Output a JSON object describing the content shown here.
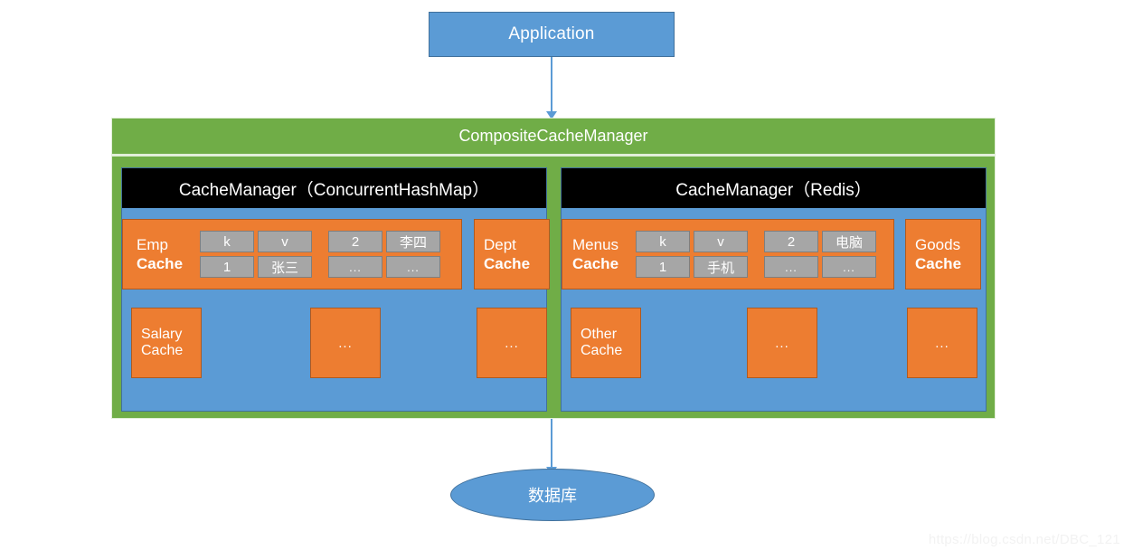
{
  "application": {
    "label": "Application"
  },
  "composite": {
    "title": "CompositeCacheManager"
  },
  "managers": [
    {
      "id": "concurrent-hash-map",
      "header": "CacheManager（ConcurrentHashMap）",
      "top_row": {
        "wide_cache": {
          "name": "Emp",
          "sub": "Cache",
          "tables": [
            {
              "rows": [
                [
                  "k",
                  "v"
                ],
                [
                  "1",
                  "张三"
                ]
              ]
            },
            {
              "rows": [
                [
                  "2",
                  "李四"
                ],
                [
                  "...",
                  "..."
                ]
              ]
            }
          ]
        },
        "small_cache": {
          "name": "Dept",
          "sub": "Cache"
        }
      },
      "bottom_row": {
        "named_cache": {
          "name": "Salary",
          "sub": "Cache"
        },
        "placeholder_caches": [
          "...",
          "..."
        ]
      }
    },
    {
      "id": "redis",
      "header": "CacheManager（Redis）",
      "top_row": {
        "wide_cache": {
          "name": "Menus",
          "sub": "Cache",
          "tables": [
            {
              "rows": [
                [
                  "k",
                  "v"
                ],
                [
                  "1",
                  "手机"
                ]
              ]
            },
            {
              "rows": [
                [
                  "2",
                  "电脑"
                ],
                [
                  "...",
                  "..."
                ]
              ]
            }
          ]
        },
        "small_cache": {
          "name": "Goods",
          "sub": "Cache"
        }
      },
      "bottom_row": {
        "named_cache": {
          "name": "Other",
          "sub": "Cache"
        },
        "placeholder_caches": [
          "...",
          "..."
        ]
      }
    }
  ],
  "database": {
    "label": "数据库"
  },
  "watermark": {
    "text": "https://blog.csdn.net/DBC_121"
  },
  "colors": {
    "application_fill": "#5b9bd5",
    "composite_fill": "#70ad47",
    "manager_fill": "#5b9bd5",
    "manager_header_fill": "#000000",
    "cache_fill": "#ed7d31",
    "kv_cell_fill": "#a6a6a6",
    "arrow": "#5b9bd5",
    "watermark": "#f2f2f2"
  }
}
